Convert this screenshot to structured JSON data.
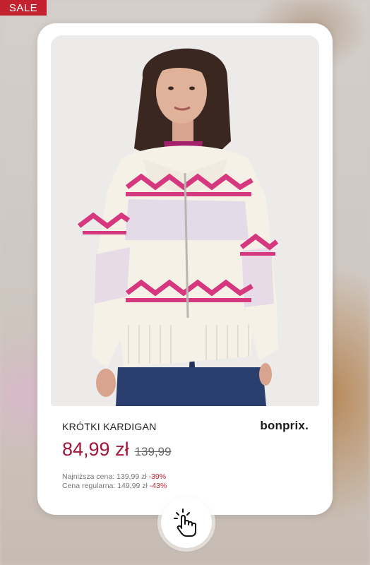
{
  "sale_badge": "SALE",
  "product": {
    "title": "KRÓTKI KARDIGAN",
    "brand": "bonprix.",
    "price": "84,99 zł",
    "old_price": "139,99",
    "lowest_price_label": "Najniższa cena: 139,99 zł",
    "lowest_price_discount": "-39%",
    "regular_price_label": "Cena regularna: 149,99 zł",
    "regular_price_discount": "-43%"
  },
  "icons": {
    "tap": "hand-tap-icon"
  },
  "colors": {
    "sale": "#c4212e",
    "price": "#a3163a",
    "pattern": "#d6387f"
  }
}
